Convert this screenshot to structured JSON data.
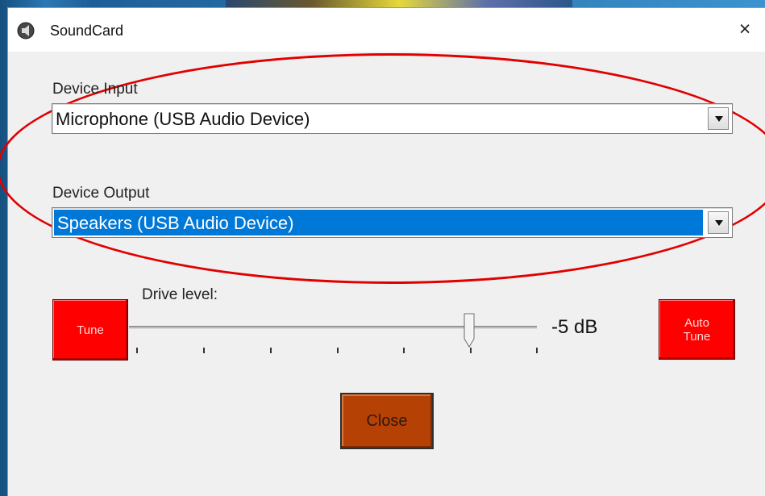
{
  "window": {
    "title": "SoundCard",
    "close_symbol": "×"
  },
  "input": {
    "label": "Device Input",
    "selected": "Microphone (USB Audio Device)"
  },
  "output": {
    "label": "Device Output",
    "selected": "Speakers (USB Audio Device)"
  },
  "drive": {
    "label": "Drive level:",
    "value_text": "-5 dB",
    "slider_value_fraction": 0.83
  },
  "buttons": {
    "tune": "Tune",
    "auto_tune_line1": "Auto",
    "auto_tune_line2": "Tune",
    "close": "Close"
  },
  "colors": {
    "selection_blue": "#0078d7",
    "tune_red": "#ff0000",
    "close_orange": "#b64104",
    "annotation_red": "#e00000"
  },
  "icons": {
    "app": "speaker-icon",
    "dropdown": "chevron-down-icon",
    "close": "close-icon"
  }
}
